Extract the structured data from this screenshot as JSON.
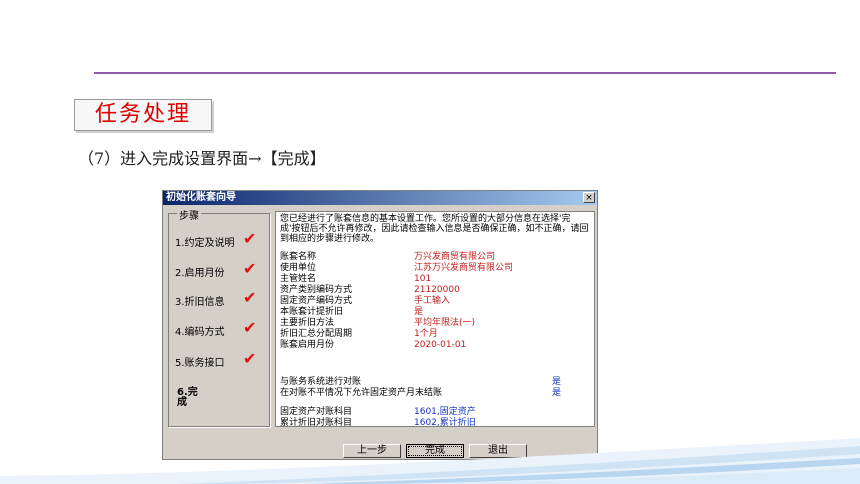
{
  "slide": {
    "title": "任务处理",
    "caption": "（7）进入完成设置界面→【完成】"
  },
  "dialog": {
    "title": "初始化账套向导",
    "close_label": "×",
    "steps_legend": "步骤",
    "steps": [
      {
        "label": "1.约定及说明",
        "done": true
      },
      {
        "label": "2.启用月份",
        "done": true
      },
      {
        "label": "3.折旧信息",
        "done": true
      },
      {
        "label": "4.编码方式",
        "done": true
      },
      {
        "label": "5.账务接口",
        "done": true
      }
    ],
    "current_step": "6.完成",
    "check_mark": "✔",
    "intro": "您已经进行了账套信息的基本设置工作。您所设置的大部分信息在选择'完成'按钮后不允许再修改，因此请检查输入信息是否确保正确，如不正确，请回到相应的步骤进行修改。",
    "summary": [
      {
        "label": "账套名称",
        "value": "万兴发商贸有限公司"
      },
      {
        "label": "使用单位",
        "value": "江苏万兴发商贸有限公司"
      },
      {
        "label": "主管姓名",
        "value": "101"
      },
      {
        "label": "资产类别编码方式",
        "value": "21120000"
      },
      {
        "label": "固定资产编码方式",
        "value": "手工输入"
      },
      {
        "label": "本账套计提折旧",
        "value": "是"
      },
      {
        "label": "主要折旧方法",
        "value": "平均年限法(一)"
      },
      {
        "label": "折旧汇总分配周期",
        "value": "1个月"
      },
      {
        "label": "账套启用月份",
        "value": "2020-01-01"
      }
    ],
    "interface": [
      {
        "label": "与账务系统进行对账",
        "value": "是"
      },
      {
        "label": "在对账不平情况下允许固定资产月末结账",
        "value": "是"
      }
    ],
    "accounts": [
      {
        "label": "固定资产对账科目",
        "value": "1601,固定资产"
      },
      {
        "label": "累计折旧对账科目",
        "value": "1602,累计折旧"
      }
    ],
    "buttons": {
      "prev": "上一步",
      "finish": "完成",
      "exit": "退出"
    }
  }
}
